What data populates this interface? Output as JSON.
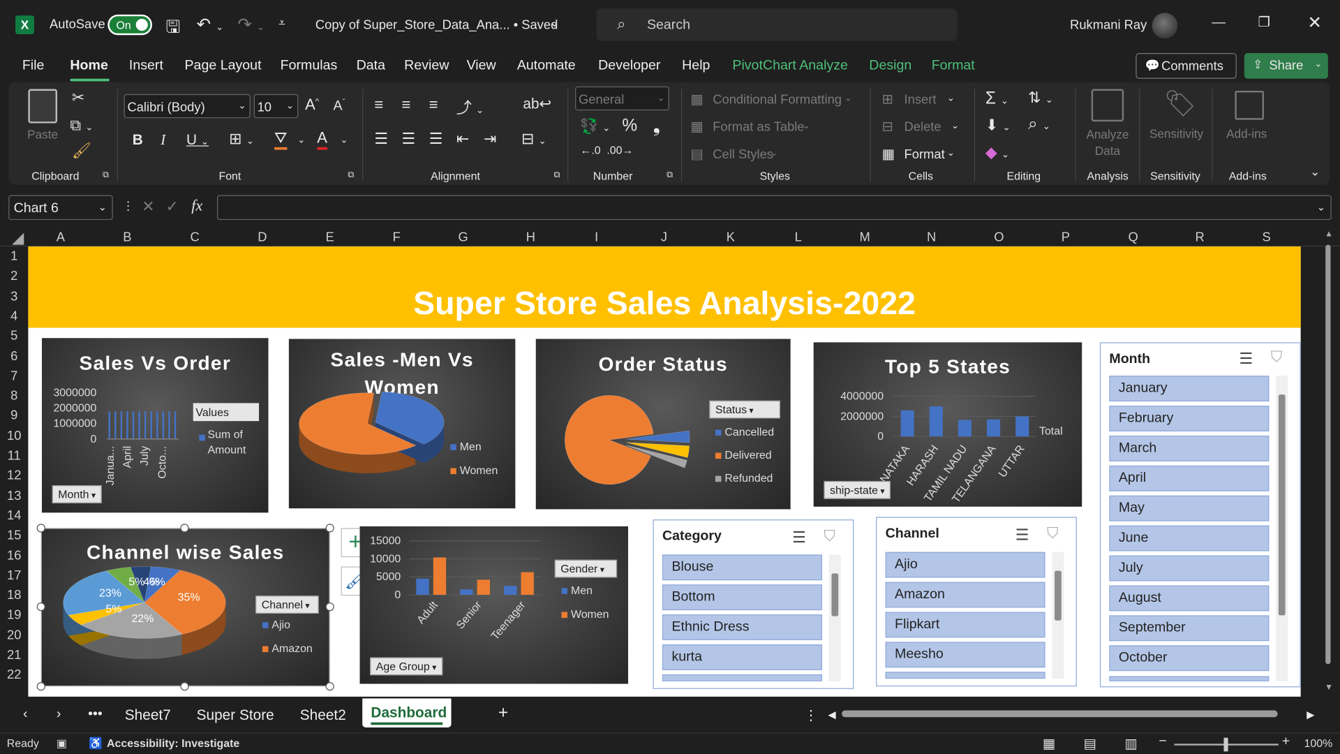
{
  "titlebar": {
    "autosave_label": "AutoSave",
    "autosave_state": "On",
    "doc_title": "Copy of Super_Store_Data_Ana... • Saved",
    "search_placeholder": "Search",
    "user": "Rukmani Ray"
  },
  "menu": {
    "tabs": [
      "File",
      "Home",
      "Insert",
      "Page Layout",
      "Formulas",
      "Data",
      "Review",
      "View",
      "Automate",
      "Developer",
      "Help",
      "PivotChart Analyze",
      "Design",
      "Format"
    ],
    "comments": "Comments",
    "share": "Share"
  },
  "ribbon": {
    "paste": "Paste",
    "clipboard": "Clipboard",
    "font_name": "Calibri (Body)",
    "font_size": "10",
    "font": "Font",
    "alignment": "Alignment",
    "number_format": "General",
    "number": "Number",
    "conditional_formatting": "Conditional Formatting",
    "format_as_table": "Format as Table",
    "cell_styles": "Cell Styles",
    "styles": "Styles",
    "insert": "Insert",
    "delete": "Delete",
    "format": "Format",
    "cells": "Cells",
    "editing": "Editing",
    "analyze_data": "Analyze Data",
    "analysis": "Analysis",
    "sensitivity": "Sensitivity",
    "addins": "Add-ins"
  },
  "formula_bar": {
    "name_box": "Chart 6",
    "fx": "fx"
  },
  "grid": {
    "columns": [
      "A",
      "B",
      "C",
      "D",
      "E",
      "F",
      "G",
      "H",
      "I",
      "J",
      "K",
      "L",
      "M",
      "N",
      "O",
      "P",
      "Q",
      "R",
      "S"
    ],
    "rows": [
      "1",
      "2",
      "3",
      "4",
      "5",
      "6",
      "7",
      "8",
      "9",
      "10",
      "11",
      "12",
      "13",
      "14",
      "15",
      "16",
      "17",
      "18",
      "19",
      "20",
      "21",
      "22"
    ]
  },
  "dashboard": {
    "title": "Super Store Sales Analysis-2022"
  },
  "chart_data": [
    {
      "type": "bar",
      "title": "Sales Vs Order",
      "y_ticks": [
        "3000000",
        "2000000",
        "1000000",
        "0"
      ],
      "categories": [
        "Janua...",
        "April",
        "July",
        "Octo..."
      ],
      "values": [
        1800000,
        1800000,
        1800000,
        1800000,
        1800000,
        1800000,
        1800000,
        1800000,
        1800000,
        1800000,
        1800000,
        1800000
      ],
      "ylim": [
        0,
        3000000
      ],
      "legend_title": "Values",
      "series": [
        {
          "name": "Sum of Amount"
        }
      ],
      "filter_button": "Month"
    },
    {
      "type": "pie",
      "title": "Sales -Men Vs Women",
      "series": [
        {
          "name": "Men",
          "color": "#4472c4",
          "value": 36
        },
        {
          "name": "Women",
          "color": "#ed7d31",
          "value": 64
        }
      ]
    },
    {
      "type": "pie",
      "title": "Order Status",
      "legend_title": "Status",
      "series": [
        {
          "name": "Cancelled",
          "color": "#4472c4",
          "value": 3
        },
        {
          "name": "Delivered",
          "color": "#ed7d31",
          "value": 92
        },
        {
          "name": "Refunded",
          "color": "#a5a5a5",
          "value": 2
        },
        {
          "name": "",
          "color": "#ffc000",
          "value": 3
        }
      ]
    },
    {
      "type": "bar",
      "title": "Top 5 States",
      "y_ticks": [
        "4000000",
        "2000000",
        "0"
      ],
      "categories": [
        "...NATAKA",
        "...HARASH...",
        "TAMIL NADU",
        "TELANGANA",
        "UTTAR..."
      ],
      "values": [
        2600000,
        3000000,
        1650000,
        1700000,
        2000000
      ],
      "ylim": [
        0,
        4000000
      ],
      "series": [
        {
          "name": "Total"
        }
      ],
      "filter_button": "ship-state"
    },
    {
      "type": "pie",
      "title": "Channel wise Sales",
      "legend_title": "Channel",
      "series": [
        {
          "name": "Ajio",
          "color": "#4472c4",
          "value": 6
        },
        {
          "name": "Amazon",
          "color": "#ed7d31",
          "value": 35
        },
        {
          "name": "",
          "color": "#a5a5a5",
          "value": 22
        },
        {
          "name": "",
          "color": "#ffc000",
          "value": 5
        },
        {
          "name": "",
          "color": "#5b9bd5",
          "value": 23
        },
        {
          "name": "",
          "color": "#70ad47",
          "value": 5
        },
        {
          "name": "",
          "color": "#264478",
          "value": 4
        }
      ],
      "data_labels": [
        "35%",
        "22%",
        "23%",
        "5%",
        "5%",
        "4%",
        "6%"
      ]
    },
    {
      "type": "bar",
      "y_ticks": [
        "15000",
        "10000",
        "5000",
        "0"
      ],
      "categories": [
        "Adult",
        "Senior",
        "Teenager"
      ],
      "legend_title": "Gender",
      "series": [
        {
          "name": "Men",
          "color": "#4472c4",
          "values": [
            4500,
            1500,
            2500
          ]
        },
        {
          "name": "Women",
          "color": "#ed7d31",
          "values": [
            10400,
            4200,
            6300
          ]
        }
      ],
      "ylim": [
        0,
        15000
      ],
      "filter_button": "Age Group"
    }
  ],
  "slicers": {
    "category": {
      "title": "Category",
      "items": [
        "Blouse",
        "Bottom",
        "Ethnic Dress",
        "kurta"
      ]
    },
    "channel": {
      "title": "Channel",
      "items": [
        "Ajio",
        "Amazon",
        "Flipkart",
        "Meesho"
      ]
    },
    "month": {
      "title": "Month",
      "items": [
        "January",
        "February",
        "March",
        "April",
        "May",
        "June",
        "July",
        "August",
        "September",
        "October"
      ]
    }
  },
  "sheet_tabs": [
    "Sheet7",
    "Super Store",
    "Sheet2",
    "Dashboard"
  ],
  "status": {
    "ready": "Ready",
    "accessibility": "Accessibility: Investigate",
    "zoom": "100%"
  }
}
